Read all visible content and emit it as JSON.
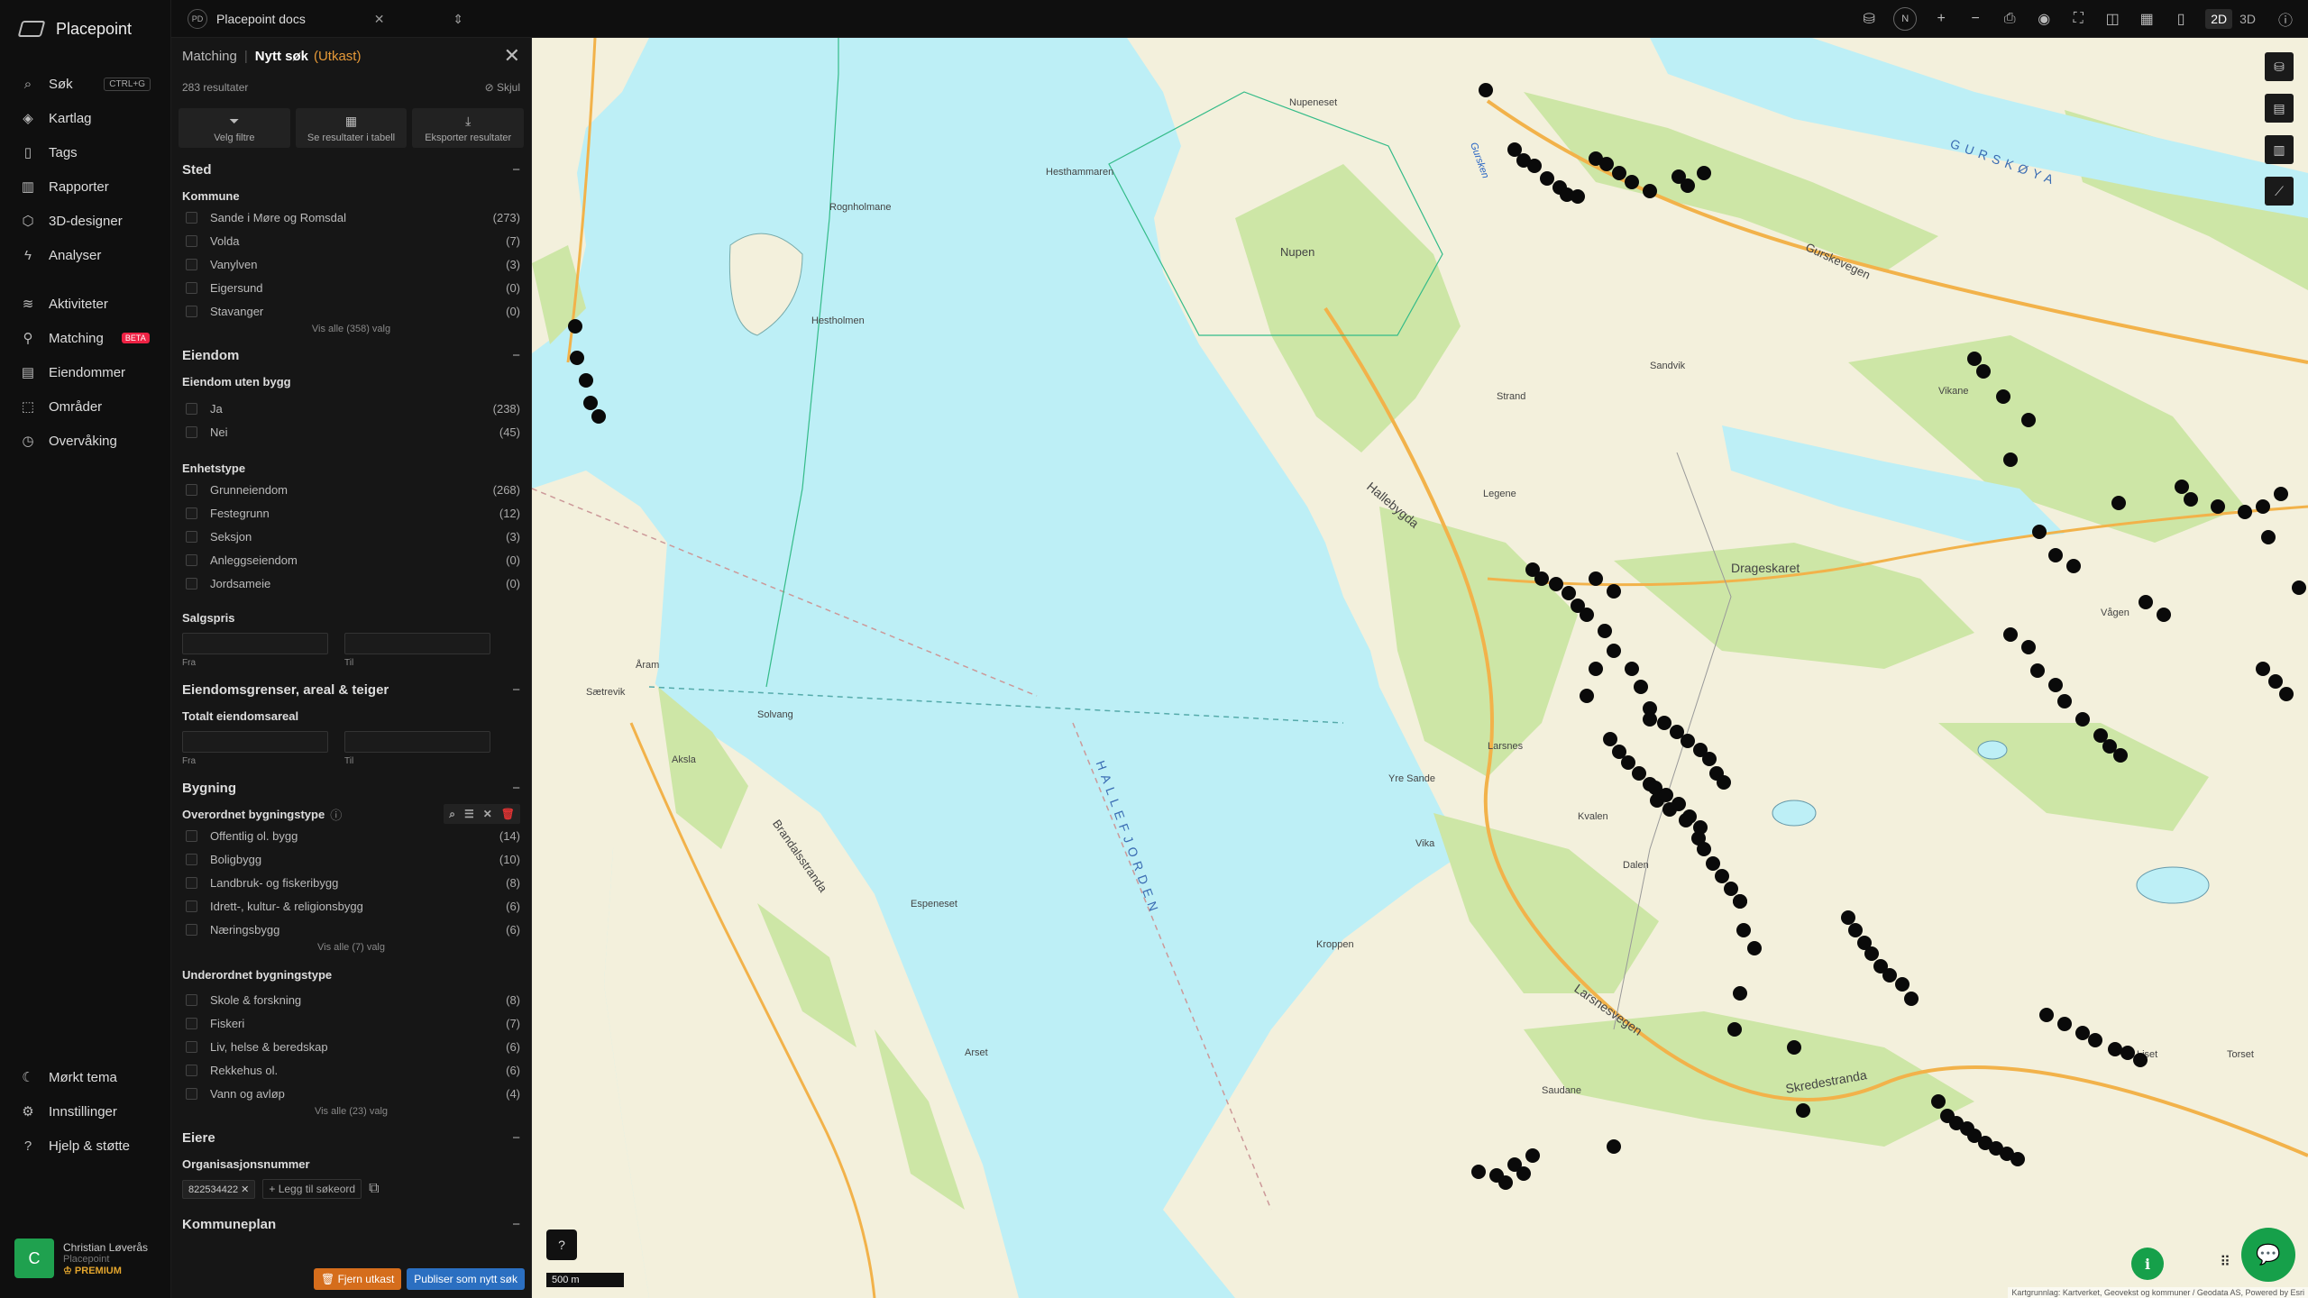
{
  "app": {
    "name": "Placepoint"
  },
  "nav": {
    "items": [
      {
        "label": "Søk",
        "shortcut": "CTRL+G"
      },
      {
        "label": "Kartlag"
      },
      {
        "label": "Tags"
      },
      {
        "label": "Rapporter"
      },
      {
        "label": "3D-designer"
      },
      {
        "label": "Analyser"
      },
      {
        "label": "Aktiviteter"
      },
      {
        "label": "Matching",
        "badge": "BETA"
      },
      {
        "label": "Eiendommer"
      },
      {
        "label": "Områder"
      },
      {
        "label": "Overvåking"
      }
    ],
    "bottom": [
      {
        "label": "Mørkt tema"
      },
      {
        "label": "Innstillinger"
      },
      {
        "label": "Hjelp & støtte"
      }
    ],
    "user": {
      "initial": "C",
      "name": "Christian Løverås",
      "org": "Placepoint",
      "plan": "PREMIUM"
    }
  },
  "topbar": {
    "doc_badge": "PD",
    "doc_title": "Placepoint docs",
    "view_2d": "2D",
    "view_3d": "3D",
    "compass": "N"
  },
  "panel": {
    "breadcrumb": "Matching",
    "title": "Nytt søk",
    "status": "(Utkast)",
    "results": "283 resultater",
    "hide": "Skjul",
    "actions": [
      "Velg filtre",
      "Se resultater i tabell",
      "Eksporter resultater"
    ],
    "sted": {
      "heading": "Sted",
      "kommune_label": "Kommune",
      "kommune": [
        {
          "name": "Sande i Møre og Romsdal",
          "count": "(273)"
        },
        {
          "name": "Volda",
          "count": "(7)"
        },
        {
          "name": "Vanylven",
          "count": "(3)"
        },
        {
          "name": "Eigersund",
          "count": "(0)"
        },
        {
          "name": "Stavanger",
          "count": "(0)"
        }
      ],
      "more": "Vis alle (358) valg"
    },
    "eiendom": {
      "heading": "Eiendom",
      "uten_bygg_label": "Eiendom uten bygg",
      "uten_bygg": [
        {
          "name": "Ja",
          "count": "(238)"
        },
        {
          "name": "Nei",
          "count": "(45)"
        }
      ],
      "enhetstype_label": "Enhetstype",
      "enhetstype": [
        {
          "name": "Grunneiendom",
          "count": "(268)"
        },
        {
          "name": "Festegrunn",
          "count": "(12)"
        },
        {
          "name": "Seksjon",
          "count": "(3)"
        },
        {
          "name": "Anleggseiendom",
          "count": "(0)"
        },
        {
          "name": "Jordsameie",
          "count": "(0)"
        }
      ],
      "salgspris_label": "Salgspris",
      "from": "Fra",
      "to": "Til"
    },
    "grenser": {
      "heading": "Eiendomsgrenser, areal & teiger",
      "areal_label": "Totalt eiendomsareal",
      "from": "Fra",
      "to": "Til"
    },
    "bygning": {
      "heading": "Bygning",
      "overordnet_label": "Overordnet bygningstype",
      "overordnet": [
        {
          "name": "Offentlig ol. bygg",
          "count": "(14)"
        },
        {
          "name": "Boligbygg",
          "count": "(10)"
        },
        {
          "name": "Landbruk- og fiskeribygg",
          "count": "(8)"
        },
        {
          "name": "Idrett-, kultur- & religionsbygg",
          "count": "(6)"
        },
        {
          "name": "Næringsbygg",
          "count": "(6)"
        }
      ],
      "overordnet_more": "Vis alle (7) valg",
      "underordnet_label": "Underordnet bygningstype",
      "underordnet": [
        {
          "name": "Skole & forskning",
          "count": "(8)"
        },
        {
          "name": "Fiskeri",
          "count": "(7)"
        },
        {
          "name": "Liv, helse & beredskap",
          "count": "(6)"
        },
        {
          "name": "Rekkehus ol.",
          "count": "(6)"
        },
        {
          "name": "Vann og avløp",
          "count": "(4)"
        }
      ],
      "underordnet_more": "Vis alle (23) valg"
    },
    "eiere": {
      "heading": "Eiere",
      "org_label": "Organisasjonsnummer",
      "org_chip": "822534422",
      "add_keyword": "Legg til søkeord"
    },
    "kommuneplan": {
      "heading": "Kommuneplan"
    },
    "footer": {
      "remove": "Fjern utkast",
      "publish": "Publiser som nytt søk"
    }
  },
  "map": {
    "scale": "500 m",
    "attribution": "Kartgrunnlag: Kartverket, Geovekst og kommuner / Geodata AS, Powered by Esri",
    "labels": {
      "fjord": "HALLEFJORDEN",
      "island": "GURSKØYA",
      "hallebygda": "Hallebygda",
      "drageskaret": "Drageskaret",
      "larsnesvegen": "Larsnesvegen",
      "skredestranda": "Skredestranda",
      "gurskevegen": "Gurskevegen",
      "brandalsstranda": "Brandalsstranda",
      "gursken": "Gursken",
      "nupen": "Nupen",
      "larsnes": "Larsnes",
      "aaram": "Åram",
      "sandvik": "Sandvik",
      "kroppen": "Kroppen",
      "arset": "Arset",
      "espeneset": "Espeneset",
      "saudane": "Saudane",
      "kvalen": "Kvalen",
      "dalen": "Dalen",
      "vika": "Vika",
      "strand": "Strand",
      "legene": "Legene",
      "aksla": "Aksla",
      "solvang": "Solvang",
      "saetrevik": "Sætrevik",
      "yresande": "Yre Sande",
      "vagen": "Vågen",
      "liset": "Liset",
      "torset": "Torset",
      "hestholmen": "Hestholmen",
      "rognholmane": "Rognholmane",
      "nupeneset": "Nupeneset",
      "hesthammaren": "Hesthammaren",
      "vikane": "Vikane"
    }
  },
  "colors": {
    "accent": "#e69938",
    "green": "#16a04a",
    "blue": "#2b6fc1",
    "sea": "#bdeff6",
    "land": "#f3f0dc",
    "veg": "#cde6a6"
  }
}
